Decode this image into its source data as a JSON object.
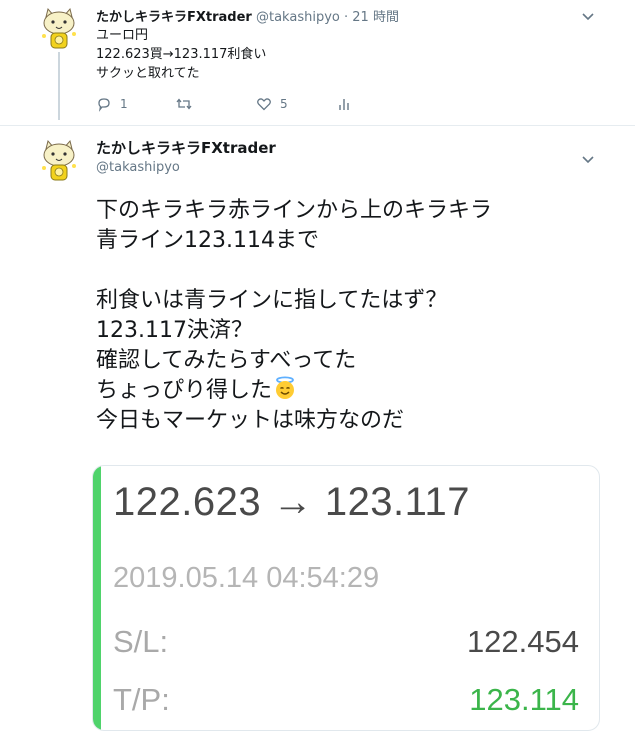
{
  "tweet1": {
    "display_name": "たかしキラキラFXtrader",
    "handle": "@takashipyo",
    "separator": "·",
    "time": "21 時間",
    "lines": [
      "ユーロ円",
      "122.623買→123.117利食い",
      "サクッと取れてた"
    ],
    "actions": {
      "reply_count": "1",
      "retweet_count": "",
      "like_count": "5"
    }
  },
  "tweet2": {
    "display_name": "たかしキラキラFXtrader",
    "handle": "@takashipyo",
    "lines": [
      "下のキラキラ赤ラインから上のキラキラ",
      "青ライン123.114まで",
      "",
      "利食いは青ラインに指してたはず？",
      "123.117決済？",
      "確認してみたらすべってた",
      "ちょっぴり得した",
      "今日もマーケットは味方なのだ"
    ],
    "emoji": "smiling-face-with-halo",
    "card": {
      "trade": "122.623 → 123.117",
      "datetime": "2019.05.14 04:54:29",
      "sl_label": "S/L:",
      "sl_value": "122.454",
      "tp_label": "T/P:",
      "tp_value": "123.114",
      "accent_color": "#4fd36b",
      "tp_color": "#3bb54a"
    }
  }
}
